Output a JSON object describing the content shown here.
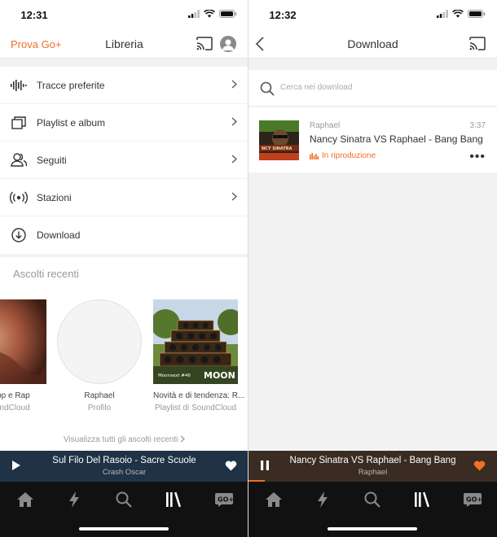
{
  "colors": {
    "accent": "#f26f23",
    "player_left_bg": "#1f3246",
    "player_right_bg": "#3a2c22",
    "tabbar_bg": "#111111"
  },
  "left": {
    "status_time": "12:31",
    "nav": {
      "prova": "Prova Go+",
      "title": "Libreria"
    },
    "menu": [
      {
        "label": "Tracce preferite",
        "icon": "waveform-icon"
      },
      {
        "label": "Playlist e album",
        "icon": "stack-icon"
      },
      {
        "label": "Seguiti",
        "icon": "users-icon"
      },
      {
        "label": "Stazioni",
        "icon": "radio-icon"
      },
      {
        "label": "Download",
        "icon": "download-icon"
      }
    ],
    "recent": {
      "heading": "Ascolti recenti",
      "cards": [
        {
          "name": "...p-hop e Rap",
          "sub": "...SoundCloud"
        },
        {
          "name": "Raphael",
          "sub": "Profilo"
        },
        {
          "name": "Novità e di tendenza: R...",
          "sub": "Playlist di SoundCloud"
        }
      ],
      "view_all": "Visualizza tutti gli ascolti recenti"
    },
    "player": {
      "title": "Sul Filo Del Rasoio - Sacre Scuole",
      "artist": "Crash Oscar"
    }
  },
  "right": {
    "status_time": "12:32",
    "nav": {
      "title": "Download"
    },
    "search": {
      "placeholder": "Cerca nei download"
    },
    "track": {
      "artist": "Raphael",
      "duration": "3:37",
      "title": "Nancy Sinatra VS Raphael - Bang Bang",
      "status": "In riproduzione"
    },
    "player": {
      "title": "Nancy Sinatra VS Raphael - Bang Bang",
      "artist": "Raphael"
    }
  },
  "tabs": [
    "home-icon",
    "lightning-icon",
    "search-icon",
    "library-icon",
    "go-plus-icon"
  ]
}
